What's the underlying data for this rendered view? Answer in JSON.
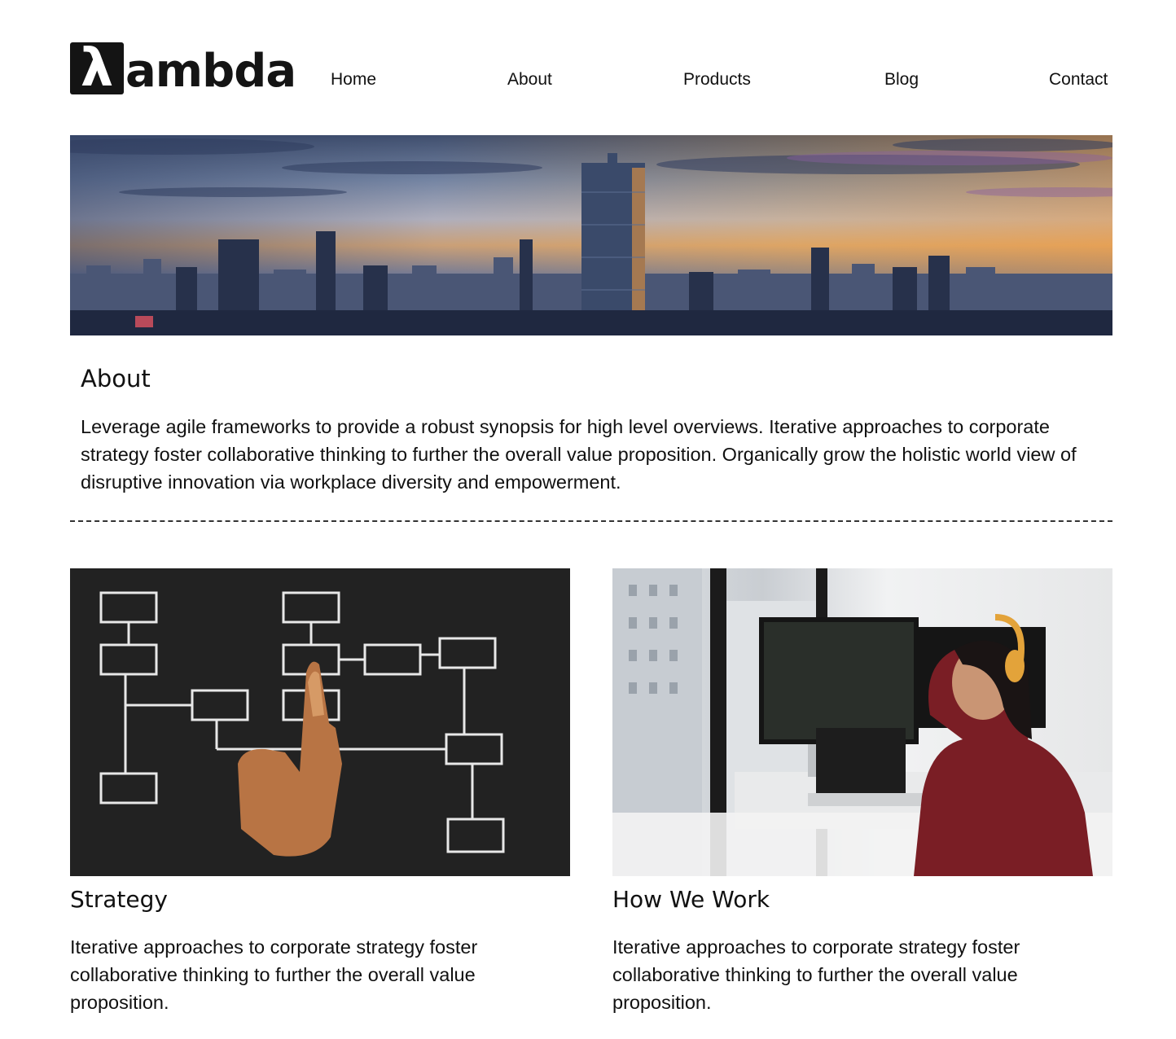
{
  "header": {
    "logo_mark": "λ",
    "logo_text": "ambda",
    "nav": [
      {
        "label": "Home"
      },
      {
        "label": "About"
      },
      {
        "label": "Products"
      },
      {
        "label": "Blog"
      },
      {
        "label": "Contact"
      }
    ]
  },
  "hero": {
    "image": "city-skyline-sunset-image"
  },
  "about": {
    "title": "About",
    "text": "Leverage agile frameworks to provide a robust synopsis for high level overviews. Iterative approaches to corporate strategy foster collaborative thinking to further the overall value proposition. Organically grow the holistic world view of disruptive innovation via workplace diversity and empowerment."
  },
  "cards": [
    {
      "image": "flowchart-chalkboard-image",
      "title": "Strategy",
      "text": "Iterative approaches to corporate strategy foster collaborative thinking to further the overall value proposition."
    },
    {
      "image": "developer-at-desk-image",
      "title": "How We Work",
      "text": "Iterative approaches to corporate strategy foster collaborative thinking to further the overall value proposition."
    }
  ],
  "colors": {
    "text": "#111111",
    "background": "#ffffff",
    "logo": "#141414"
  }
}
